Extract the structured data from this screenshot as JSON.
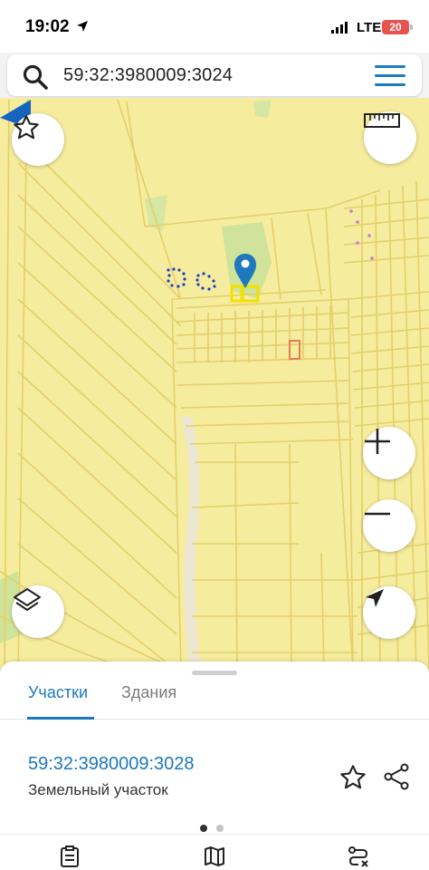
{
  "status_bar": {
    "time": "19:02",
    "network": "LTE",
    "battery": "20",
    "battery_color": "#e9534e"
  },
  "search": {
    "query": "59:32:3980009:3024",
    "icon": "search-icon",
    "menu_icon": "hamburger-menu-icon"
  },
  "map": {
    "background_color": "#f6ec9d",
    "line_color": "#e3cf6b",
    "forest_color": "#cfe39a",
    "marker_color": "#1e78bd",
    "buttons": {
      "favorite": "star-icon",
      "ruler": "ruler-icon",
      "zoom_in": "plus-icon",
      "zoom_out": "minus-icon",
      "layers": "layers-icon",
      "locate": "location-arrow-icon"
    }
  },
  "panel": {
    "tabs": [
      {
        "label": "Участки",
        "active": true
      },
      {
        "label": "Здания",
        "active": false
      }
    ],
    "result": {
      "cadastral_number": "59:32:3980009:3028",
      "type": "Земельный участок"
    },
    "page_indicator": {
      "pages": 2,
      "current": 1
    },
    "accent_color": "#1a78bd"
  },
  "bottom_nav": {
    "items": [
      "clipboard-icon",
      "map-icon",
      "route-icon"
    ]
  }
}
